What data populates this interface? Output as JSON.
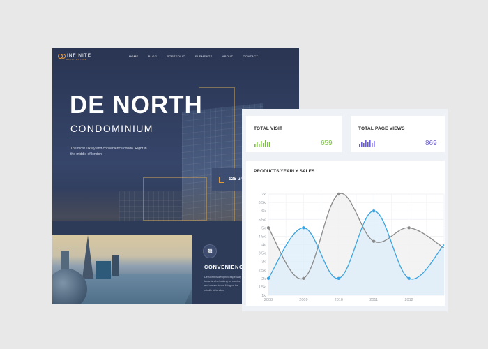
{
  "site": {
    "logo_text": "INFINITE",
    "logo_sub": "ARCHITECTURE",
    "menu": [
      {
        "label": "HOME",
        "active": true
      },
      {
        "label": "BLOG"
      },
      {
        "label": "PORTFOLIO"
      },
      {
        "label": "ELEMENTS"
      },
      {
        "label": "ABOUT"
      },
      {
        "label": "CONTACT"
      }
    ],
    "hero_title": "DE NORTH",
    "hero_subtitle": "CONDOMINIUM",
    "hero_description": "The most luxury and convenience condo. Right in the middle of london.",
    "units_text": "125 un",
    "convenience_title": "CONVENIENCE",
    "convenience_description": "De North is designed especially for tenants who looking for comfort and convenience living at the middle of london"
  },
  "stats": {
    "total_visit": {
      "label": "TOTAL VISIT",
      "value": "659",
      "color": "#7bc043"
    },
    "total_page_views": {
      "label": "TOTAL PAGE VIEWS",
      "value": "869",
      "color": "#6b5fd3"
    }
  },
  "chart_title": "PRODUCTS YEARLY SALES",
  "chart_data": {
    "type": "line",
    "title": "PRODUCTS YEARLY SALES",
    "x": [
      "2008",
      "2009",
      "2010",
      "2011",
      "2012"
    ],
    "y_ticks": [
      "1k",
      "1.5k",
      "2k",
      "2.5k",
      "3k",
      "3.5k",
      "4k",
      "4.5k",
      "5k",
      "5.5k",
      "6k",
      "6.5k",
      "7k"
    ],
    "ylim": [
      1000,
      7000
    ],
    "series": [
      {
        "values": [
          5000,
          2000,
          7000,
          4200,
          5000,
          3800
        ],
        "color": "#8a8a8a",
        "fill": "#f2f2f2"
      },
      {
        "values": [
          2000,
          5000,
          2000,
          6000,
          2000,
          4000
        ],
        "color": "#3aa4e0",
        "fill": "#dcedf9"
      }
    ],
    "grid": true
  }
}
